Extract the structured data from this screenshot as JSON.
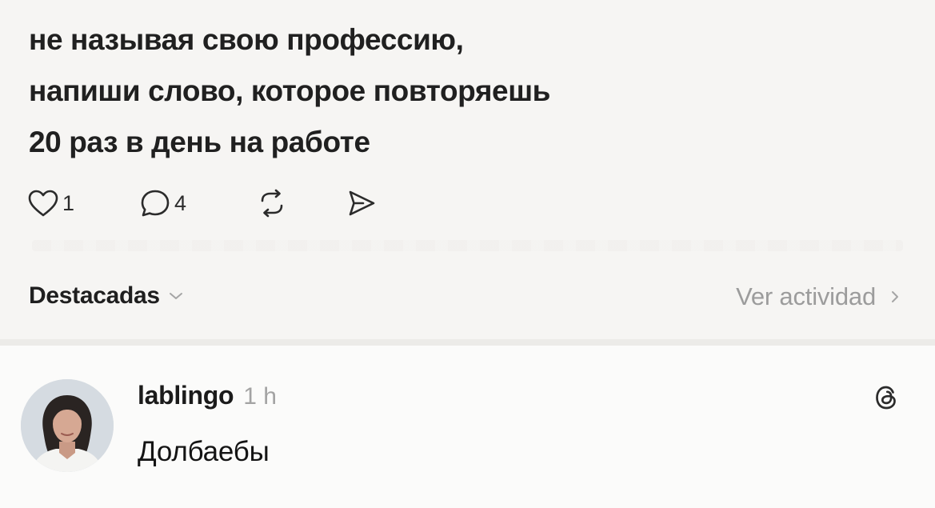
{
  "post": {
    "lines": [
      "не называя свою профессию,",
      "напиши слово, которое повторяешь",
      "20 раз в день на работе"
    ]
  },
  "actions": {
    "like": {
      "icon": "heart-icon",
      "count": "1"
    },
    "comment": {
      "icon": "comment-icon",
      "count": "4"
    },
    "repost": {
      "icon": "repost-icon"
    },
    "share": {
      "icon": "send-icon"
    }
  },
  "tabs": {
    "featured_label": "Destacadas",
    "see_activity_label": "Ver actividad"
  },
  "reply": {
    "author": "lablingo",
    "time": "1 h",
    "text": "Долбаебы",
    "avatar_icon": "avatar",
    "app_icon": "threads-icon"
  },
  "colors": {
    "background": "#f6f5f3",
    "text": "#1d1d1d",
    "muted": "#9c9c9c"
  }
}
